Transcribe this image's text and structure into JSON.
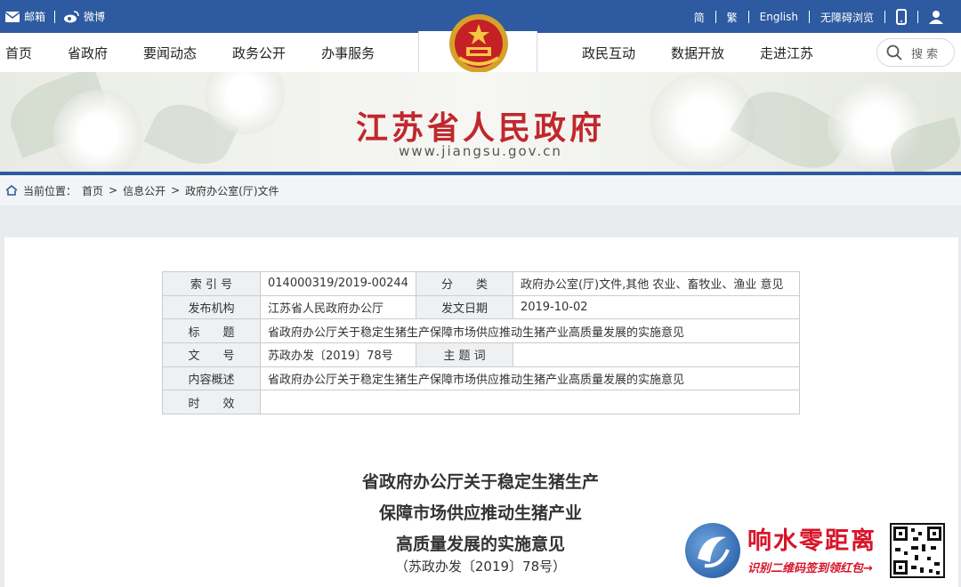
{
  "topbar": {
    "mail_label": "邮箱",
    "weibo_label": "微博",
    "lang_simplified": "简",
    "lang_traditional": "繁",
    "lang_english": "English",
    "accessibility": "无障碍浏览"
  },
  "nav": {
    "left": [
      "首页",
      "省政府",
      "要闻动态",
      "政务公开",
      "办事服务"
    ],
    "right": [
      "政民互动",
      "数据开放",
      "走进江苏"
    ],
    "search_label": "搜 索"
  },
  "banner": {
    "title": "江苏省人民政府",
    "url": "www.jiangsu.gov.cn"
  },
  "breadcrumb": {
    "prefix": "当前位置：",
    "items": [
      "首页",
      "信息公开",
      "政府办公室(厅)文件"
    ],
    "separator": ">"
  },
  "meta": {
    "index_label": "索 引 号",
    "index_value": "014000319/2019-00244",
    "category_label": "分　　类",
    "category_value": "政府办公室(厅)文件,其他 农业、畜牧业、渔业 意见",
    "issuer_label": "发布机构",
    "issuer_value": "江苏省人民政府办公厅",
    "date_label": "发文日期",
    "date_value": "2019-10-02",
    "title_label": "标　　题",
    "title_value": "省政府办公厅关于稳定生猪生产保障市场供应推动生猪产业高质量发展的实施意见",
    "docno_label": "文　　号",
    "docno_value": "苏政办发〔2019〕78号",
    "subject_label": "主 题 词",
    "subject_value": "",
    "summary_label": "内容概述",
    "summary_value": "省政府办公厅关于稳定生猪生产保障市场供应推动生猪产业高质量发展的实施意见",
    "validity_label": "时　　效",
    "validity_value": ""
  },
  "document": {
    "title_line1": "省政府办公厅关于稳定生猪生产",
    "title_line2": "保障市场供应推动生猪产业",
    "title_line3": "高质量发展的实施意见",
    "doc_no": "（苏政办发〔2019〕78号）"
  },
  "watermark": {
    "name": "响水零距离",
    "subtitle": "识别二维码签到领红包→"
  },
  "colors": {
    "topbar": "#2d5aa0",
    "title_red": "#c0282d",
    "watermark_red": "#d8142a"
  }
}
